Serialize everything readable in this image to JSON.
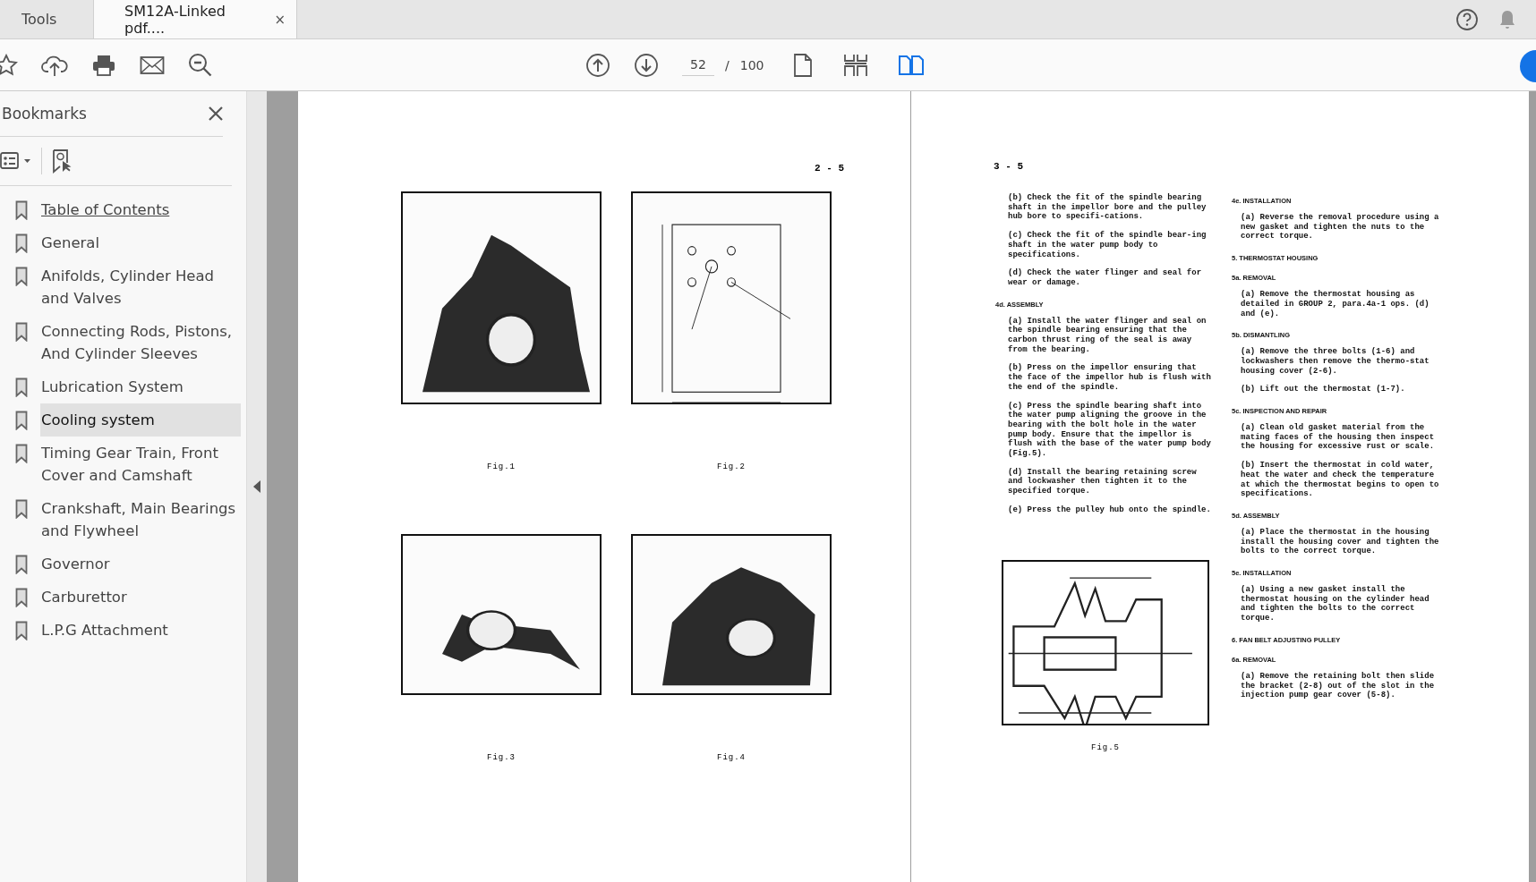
{
  "tabs": [
    {
      "label": "Tools",
      "selected": false
    },
    {
      "label": "SM12A-Linked pdf....",
      "selected": true,
      "close": "×"
    }
  ],
  "toolbar": {
    "page": "52",
    "separator": "/",
    "total": "100",
    "view_modes": [
      {
        "kind": "single",
        "selected": false
      },
      {
        "kind": "scroll",
        "selected": false
      },
      {
        "kind": "two-page",
        "selected": true
      }
    ]
  },
  "sidebar": {
    "title": "Bookmarks",
    "items": [
      {
        "label": "Table of Contents",
        "selected": false,
        "underlined": true
      },
      {
        "label": "General",
        "selected": false,
        "underlined": false
      },
      {
        "label": "Anifolds, Cylinder Head and Valves",
        "selected": false,
        "underlined": false
      },
      {
        "label": "Connecting Rods, Pistons, And Cylinder Sleeves",
        "selected": false,
        "underlined": false
      },
      {
        "label": "Lubrication System",
        "selected": false,
        "underlined": false
      },
      {
        "label": "Cooling system",
        "selected": true,
        "underlined": false
      },
      {
        "label": "Timing Gear Train, Front Cover and Camshaft",
        "selected": false,
        "underlined": false
      },
      {
        "label": "Crankshaft, Main Bearings and Flywheel",
        "selected": false,
        "underlined": false
      },
      {
        "label": "Governor",
        "selected": false,
        "underlined": false
      },
      {
        "label": "Carburettor",
        "selected": false,
        "underlined": false
      },
      {
        "label": "L.P.G Attachment",
        "selected": false,
        "underlined": false
      }
    ]
  },
  "left_page": {
    "page_number": "2 - 5",
    "figures": [
      {
        "caption": "Fig.1"
      },
      {
        "caption": "Fig.2"
      },
      {
        "caption": "Fig.3"
      },
      {
        "caption": "Fig.4"
      }
    ]
  },
  "right_page": {
    "page_number": "3 - 5",
    "columns": [
      [
        {
          "kind": "para",
          "text": "(b) Check the fit of the spindle bearing shaft in the impellor bore and the pulley hub bore to specifi-cations."
        },
        {
          "kind": "para",
          "text": "(c) Check the fit of the spindle bear-ing shaft in the water pump body to specifications."
        },
        {
          "kind": "para",
          "text": "(d) Check the water flinger and seal for wear or damage."
        },
        {
          "kind": "heading",
          "text": "4d. ASSEMBLY"
        },
        {
          "kind": "para",
          "text": "(a) Install the water flinger and seal on the spindle bearing ensuring that the carbon thrust ring of the seal is away from the bearing."
        },
        {
          "kind": "para",
          "text": "(b) Press on the impellor ensuring that the face of the impellor hub is flush with the end of the spindle."
        },
        {
          "kind": "para",
          "text": "(c) Press the spindle bearing shaft into the water pump aligning the groove in the bearing with the bolt hole in the water pump body. Ensure that the impellor is flush with the base of the water pump body (Fig.5)."
        },
        {
          "kind": "para",
          "text": "(d) Install the bearing retaining screw and lockwasher then tighten it to the specified torque."
        },
        {
          "kind": "para",
          "text": "(e) Press the pulley hub onto the spindle."
        },
        {
          "kind": "figure",
          "text": "Fig.5"
        }
      ],
      [
        {
          "kind": "heading",
          "text": "4e. INSTALLATION"
        },
        {
          "kind": "para",
          "text": "(a) Reverse the removal procedure using a new gasket and tighten the nuts to the correct torque."
        },
        {
          "kind": "heading",
          "text": "5. THERMOSTAT HOUSING"
        },
        {
          "kind": "heading",
          "text": "5a. REMOVAL"
        },
        {
          "kind": "para",
          "text": "(a) Remove the thermostat housing as detailed in GROUP 2, para.4a-1 ops. (d) and (e)."
        },
        {
          "kind": "heading",
          "text": "5b. DISMANTLING"
        },
        {
          "kind": "para",
          "text": "(a) Remove the three bolts (1-6) and lockwashers then remove the thermo-stat housing cover (2-6)."
        },
        {
          "kind": "para",
          "text": "(b) Lift out the thermostat (1-7)."
        },
        {
          "kind": "heading",
          "text": "5c. INSPECTION AND REPAIR"
        },
        {
          "kind": "para",
          "text": "(a) Clean old gasket material from the mating faces of the housing then inspect the housing for excessive rust or scale."
        },
        {
          "kind": "para",
          "text": "(b) Insert the thermostat in cold water, heat the water and check the temperature at which the thermostat begins to open to specifications."
        },
        {
          "kind": "heading",
          "text": "5d. ASSEMBLY"
        },
        {
          "kind": "para",
          "text": "(a) Place the thermostat in the housing install the housing cover and tighten the bolts to the correct torque."
        },
        {
          "kind": "heading",
          "text": "5e. INSTALLATION"
        },
        {
          "kind": "para",
          "text": "(a) Using a new gasket install the thermostat housing on the cylinder head and tighten the bolts to the correct torque."
        },
        {
          "kind": "heading",
          "text": "6. FAN BELT ADJUSTING PULLEY"
        },
        {
          "kind": "heading",
          "text": "6a. REMOVAL"
        },
        {
          "kind": "para",
          "text": "(a) Remove the retaining bolt then slide the bracket (2-8) out of the slot in the injection pump gear cover (5-8)."
        }
      ]
    ]
  }
}
